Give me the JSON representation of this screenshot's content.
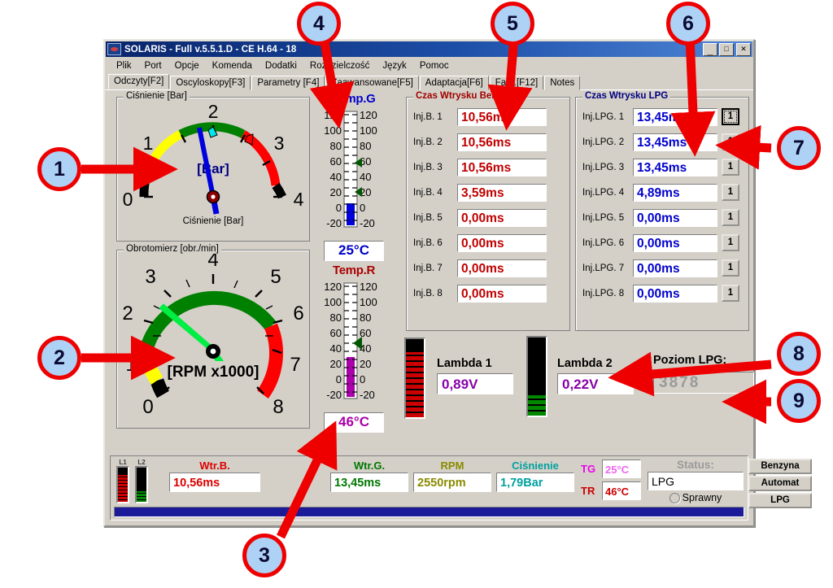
{
  "window": {
    "title": "SOLARIS - Full v.5.5.1.D - CE H.64 - 18",
    "icon": "solaris-logo-icon",
    "minimize_label": "_",
    "maximize_label": "□",
    "close_label": "✕"
  },
  "menu": {
    "items": [
      "Plik",
      "Port",
      "Opcje",
      "Komenda",
      "Dodatki",
      "Rozdzielczość",
      "Język",
      "Pomoc"
    ]
  },
  "tabs": [
    {
      "label": "Odczyty[F2]",
      "active": true
    },
    {
      "label": "Oscyloskopy[F3]",
      "active": false
    },
    {
      "label": "Parametry [F4]",
      "active": false
    },
    {
      "label": "Zaawansowane[F5]",
      "active": false
    },
    {
      "label": "Adaptacja[F6]",
      "active": false
    },
    {
      "label": "Fabr.[F12]",
      "active": false
    },
    {
      "label": "Notes",
      "active": false
    }
  ],
  "pressure_gauge": {
    "title": "Ciśnienie [Bar]",
    "caption": "Ciśnienie [Bar]",
    "center_label": "[Bar]",
    "min": 0,
    "max": 4,
    "value": 1.79,
    "ticks": [
      "0",
      "1",
      "2",
      "3",
      "4"
    ],
    "marker_cyan": 1.95,
    "marker_red": 2.55,
    "band_yellow": [
      0.3,
      1.35
    ],
    "band_green": [
      1.35,
      2.4
    ],
    "band_red": [
      2.4,
      3.85
    ]
  },
  "rpm_gauge": {
    "title": "Obrotomierz [obr./min]",
    "center_label": "[RPM x1000]",
    "min": 0,
    "max": 8,
    "value": 2.55,
    "ticks": [
      "0",
      "1",
      "2",
      "3",
      "4",
      "5",
      "6",
      "7",
      "8"
    ],
    "band_yellow": [
      0.15,
      0.85
    ],
    "band_green": [
      0.85,
      5.95
    ],
    "band_red": [
      5.95,
      7.85
    ]
  },
  "temp_gas": {
    "title": "Temp.G",
    "value": "25°C",
    "scale": [
      "120",
      "100",
      "80",
      "60",
      "40",
      "20",
      "0",
      "-20"
    ],
    "level": 25,
    "min": -20,
    "max": 120,
    "color": "#0000cc",
    "markers": [
      20,
      55
    ]
  },
  "temp_reducer": {
    "title": "Temp.R",
    "value": "46°C",
    "scale": [
      "120",
      "100",
      "80",
      "60",
      "40",
      "20",
      "0",
      "-20"
    ],
    "level": 46,
    "min": -20,
    "max": 120,
    "color": "#aa00aa",
    "markers": [
      50
    ]
  },
  "petrol_panel": {
    "title": "Czas Wtrysku Benz.",
    "rows": [
      {
        "label": "Inj.B. 1",
        "value": "10,56ms"
      },
      {
        "label": "Inj.B. 2",
        "value": "10,56ms"
      },
      {
        "label": "Inj.B. 3",
        "value": "10,56ms"
      },
      {
        "label": "Inj.B. 4",
        "value": "3,59ms"
      },
      {
        "label": "Inj.B. 5",
        "value": "0,00ms"
      },
      {
        "label": "Inj.B. 6",
        "value": "0,00ms"
      },
      {
        "label": "Inj.B. 7",
        "value": "0,00ms"
      },
      {
        "label": "Inj.B. 8",
        "value": "0,00ms"
      }
    ]
  },
  "lpg_panel": {
    "title": "Czas Wtrysku LPG",
    "rows": [
      {
        "label": "Inj.LPG. 1",
        "value": "13,45ms",
        "button": "1"
      },
      {
        "label": "Inj.LPG. 2",
        "value": "13,45ms",
        "button": "1"
      },
      {
        "label": "Inj.LPG. 3",
        "value": "13,45ms",
        "button": "1"
      },
      {
        "label": "Inj.LPG. 4",
        "value": "4,89ms",
        "button": "1"
      },
      {
        "label": "Inj.LPG. 5",
        "value": "0,00ms",
        "button": "1"
      },
      {
        "label": "Inj.LPG. 6",
        "value": "0,00ms",
        "button": "1"
      },
      {
        "label": "Inj.LPG. 7",
        "value": "0,00ms",
        "button": "1"
      },
      {
        "label": "Inj.LPG. 8",
        "value": "0,00ms",
        "button": "1"
      }
    ]
  },
  "lambda1": {
    "label": "Lambda 1",
    "value": "0,89V",
    "bar_percent": 83,
    "bar_color": "#cc0000"
  },
  "lambda2": {
    "label": "Lambda 2",
    "value": "0,22V",
    "bar_percent": 26,
    "bar_color": "#008800"
  },
  "lpg_level": {
    "label": "Poziom LPG:",
    "value": "3878"
  },
  "statusbar": {
    "minibars": [
      {
        "cap": "L1",
        "percent": 78,
        "color": "#cc0000"
      },
      {
        "cap": "L2",
        "percent": 30,
        "color": "#008800"
      }
    ],
    "petrol": {
      "cap": "Wtr.B.",
      "value": "10,56ms",
      "color": "#dd0000"
    },
    "gas": {
      "cap": "Wtr.G.",
      "value": "13,45ms",
      "color": "#007700"
    },
    "rpm": {
      "cap": "RPM",
      "value": "2550rpm",
      "color": "#8a8a00"
    },
    "pressure": {
      "cap": "Ciśnienie",
      "value": "1,79Bar",
      "color": "#00a0a0"
    },
    "temp_gas": {
      "cap": "TG",
      "value": "25°C",
      "cap_color": "#ee00ee",
      "val_color": "#ee66ee"
    },
    "temp_red": {
      "cap": "TR",
      "value": "46°C",
      "cap_color": "#cc0000",
      "val_color": "#cc0000"
    },
    "status": {
      "cap": "Status:",
      "value": "LPG",
      "radio_label": "Sprawny"
    },
    "mode_buttons": [
      "Benzyna",
      "Automat",
      "LPG"
    ]
  },
  "callouts": [
    {
      "n": "1"
    },
    {
      "n": "2"
    },
    {
      "n": "3"
    },
    {
      "n": "4"
    },
    {
      "n": "5"
    },
    {
      "n": "6"
    },
    {
      "n": "7"
    },
    {
      "n": "8"
    },
    {
      "n": "9"
    }
  ]
}
